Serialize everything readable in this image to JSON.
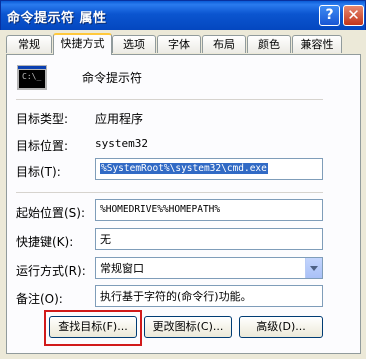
{
  "window": {
    "title": "命令提示符 属性",
    "help_glyph": "?",
    "close_glyph": "✕"
  },
  "tabs": [
    {
      "label": "常规"
    },
    {
      "label": "快捷方式"
    },
    {
      "label": "选项"
    },
    {
      "label": "字体"
    },
    {
      "label": "布局"
    },
    {
      "label": "颜色"
    },
    {
      "label": "兼容性"
    }
  ],
  "header": {
    "app_name": "命令提示符",
    "icon_text": "C:\\_"
  },
  "info": {
    "target_type_label": "目标类型:",
    "target_type_value": "应用程序",
    "target_location_label": "目标位置:",
    "target_location_value": "system32",
    "target_label": "目标(T):",
    "target_value": "%SystemRoot%\\system32\\cmd.exe"
  },
  "fields": {
    "start_in_label": "起始位置(S):",
    "start_in_value": "%HOMEDRIVE%%HOMEPATH%",
    "shortcut_key_label": "快捷键(K):",
    "shortcut_key_value": "无",
    "run_label": "运行方式(R):",
    "run_value": "常规窗口",
    "comment_label": "备注(O):",
    "comment_value": "执行基于字符的(命令行)功能。"
  },
  "buttons": {
    "find_target": "查找目标(F)...",
    "change_icon": "更改图标(C)...",
    "advanced": "高级(D)..."
  },
  "colors": {
    "highlight": "#d11a1a",
    "selection": "#316ac5"
  }
}
